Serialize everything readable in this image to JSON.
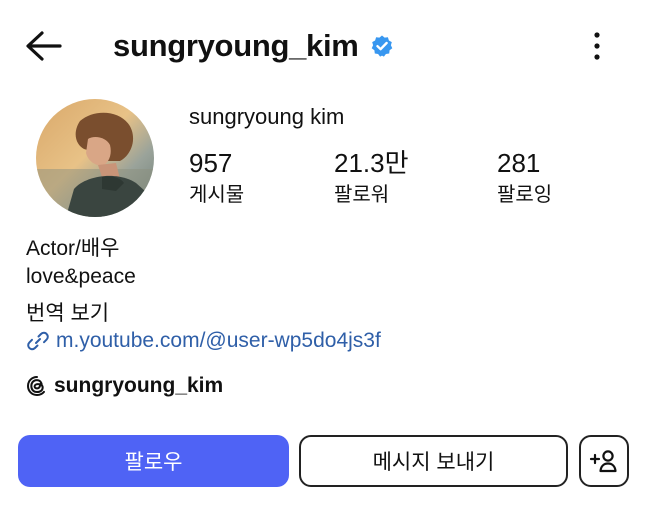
{
  "header": {
    "username": "sungryoung_kim",
    "back_icon": "back-arrow-icon",
    "verified_icon": "verified-badge-icon",
    "more_icon": "more-vertical-icon",
    "verified_color": "#3897f0"
  },
  "profile": {
    "display_name": "sungryoung kim",
    "stats": [
      {
        "value": "957",
        "label": "게시물"
      },
      {
        "value": "21.3만",
        "label": "팔로워"
      },
      {
        "value": "281",
        "label": "팔로잉"
      }
    ],
    "bio_lines": [
      "Actor/배우",
      "love&peace"
    ],
    "translate_label": "번역 보기",
    "link": "m.youtube.com/@user-wp5do4js3f",
    "link_color": "#2f5fa8",
    "threads_handle": "sungryoung_kim"
  },
  "actions": {
    "follow_label": "팔로우",
    "message_label": "메시지 보내기",
    "suggest_icon": "add-person-icon",
    "follow_color": "#4f63f5"
  }
}
